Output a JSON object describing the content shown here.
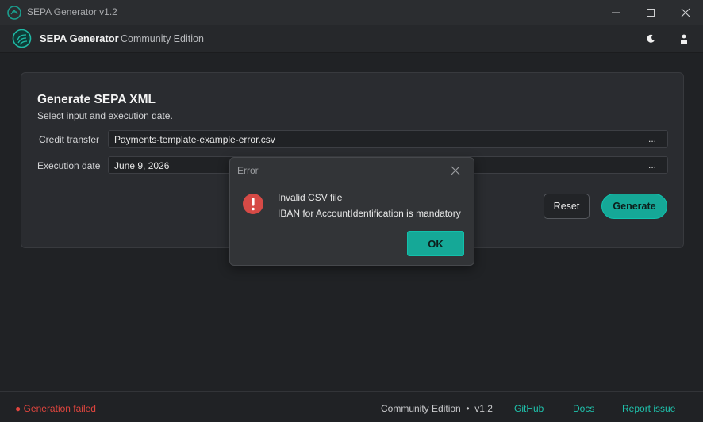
{
  "window": {
    "title": "SEPA Generator v1.2",
    "icons": [
      "app-logo-icon",
      "minimize-icon",
      "maximize-icon",
      "close-icon"
    ]
  },
  "header": {
    "app_name": "SEPA Generator",
    "edition": "Community Edition",
    "icons": [
      "theme-moon-icon",
      "user-icon"
    ]
  },
  "card": {
    "title": "Generate SEPA XML",
    "subtitle": "Select input and execution date.",
    "credit_transfer": {
      "label": "Credit transfer",
      "value": "Payments-template-example-error.csv",
      "browse": "..."
    },
    "execution_date": {
      "label": "Execution date",
      "value": "June 9, 2026",
      "browse": "..."
    },
    "reset_label": "Reset",
    "generate_label": "Generate"
  },
  "dialog": {
    "title": "Error",
    "line1": "Invalid CSV file",
    "line2": "IBAN for AccountIdentification is mandatory",
    "ok_label": "OK"
  },
  "status": {
    "message": "● Generation failed",
    "edition_version": "Community Edition  •  v1.2",
    "links": {
      "github": "GitHub",
      "docs": "Docs",
      "report": "Report issue"
    }
  },
  "colors": {
    "accent": "#15a897",
    "error": "#e0453e",
    "background": "#202225"
  }
}
